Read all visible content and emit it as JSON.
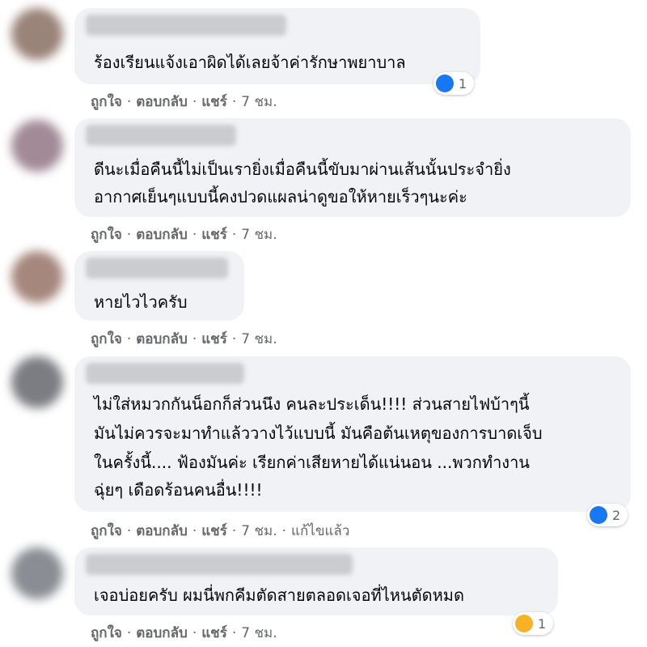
{
  "colors": {
    "bubble": "#f0f2f5",
    "meta_text": "#65676b",
    "like_blue": "#1877f2",
    "haha_yellow": "#f7b125"
  },
  "actions": {
    "like": "ถูกใจ",
    "reply": "ตอบกลับ",
    "share": "แชร์",
    "separator": "·"
  },
  "comments": [
    {
      "lines": [
        "ร้องเรียนแจ้งเอาผิดได้เลยจ้าค่ารักษาพยาบาล"
      ],
      "time": "7 ชม.",
      "reaction": {
        "icon": "like-icon",
        "count": "1"
      }
    },
    {
      "lines": [
        "ดีนะเมื่อคืนนี้ไม่เป็นเรายิ่งเมื่อคืนนี้ขับมาผ่านเส้นนั้นประจำยิ่ง",
        "อากาศเย็นๆแบบนี้คงปวดแผลน่าดูขอให้หายเร็วๆนะค่ะ"
      ],
      "time": "7 ชม."
    },
    {
      "lines": [
        "หายไวไวครับ"
      ],
      "time": "7 ชม."
    },
    {
      "lines": [
        "ไม่ใส่หมวกกันน็อกก็ส่วนนึง คนละประเด็น!!!! ส่วนสายไฟบ้าๆนี้",
        "มันไม่ควรจะมาทำแล้ววางไว้แบบนี้ มันคือต้นเหตุของการบาดเจ็บ",
        "ในครั้งนี้.... ฟ้องมันค่ะ เรียกค่าเสียหายได้แน่นอน ...พวกทำงาน",
        "ฉุ่ยๆ เดือดร้อนคนอื่น!!!!"
      ],
      "time": "7 ชม.",
      "edited": "แก้ไขแล้ว",
      "reaction": {
        "icon": "like-icon",
        "count": "2"
      }
    },
    {
      "lines": [
        "เจอบ่อยครับ ผมนี่พกคีมตัดสายตลอดเจอที่ไหนตัดหมด"
      ],
      "time": "7 ชม.",
      "reaction": {
        "icon": "haha-icon",
        "count": "1"
      }
    }
  ]
}
